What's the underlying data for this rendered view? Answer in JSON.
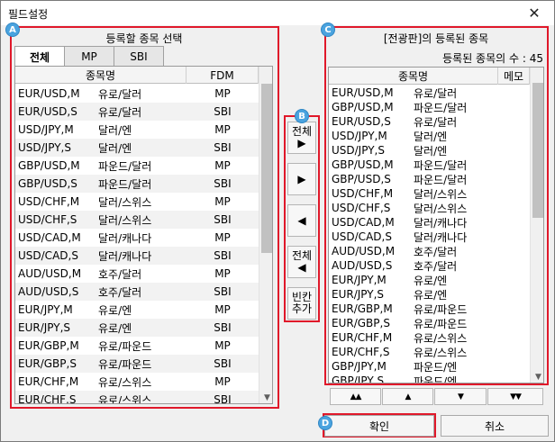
{
  "window": {
    "title": "필드설정",
    "close_glyph": "✕"
  },
  "markers": {
    "a": "A",
    "b": "B",
    "c": "C",
    "d": "D"
  },
  "left": {
    "title": "등록할 종목 선택",
    "tabs": [
      "전체",
      "MP",
      "SBI"
    ],
    "active_tab": 0,
    "columns": [
      "종목명",
      "FDM"
    ],
    "rows": [
      [
        "EUR/USD,M",
        "유로/달러",
        "MP"
      ],
      [
        "EUR/USD,S",
        "유로/달러",
        "SBI"
      ],
      [
        "USD/JPY,M",
        "달러/엔",
        "MP"
      ],
      [
        "USD/JPY,S",
        "달러/엔",
        "SBI"
      ],
      [
        "GBP/USD,M",
        "파운드/달러",
        "MP"
      ],
      [
        "GBP/USD,S",
        "파운드/달러",
        "SBI"
      ],
      [
        "USD/CHF,M",
        "달러/스위스",
        "MP"
      ],
      [
        "USD/CHF,S",
        "달러/스위스",
        "SBI"
      ],
      [
        "USD/CAD,M",
        "달러/캐나다",
        "MP"
      ],
      [
        "USD/CAD,S",
        "달러/캐나다",
        "SBI"
      ],
      [
        "AUD/USD,M",
        "호주/달러",
        "MP"
      ],
      [
        "AUD/USD,S",
        "호주/달러",
        "SBI"
      ],
      [
        "EUR/JPY,M",
        "유로/엔",
        "MP"
      ],
      [
        "EUR/JPY,S",
        "유로/엔",
        "SBI"
      ],
      [
        "EUR/GBP,M",
        "유로/파운드",
        "MP"
      ],
      [
        "EUR/GBP,S",
        "유로/파운드",
        "SBI"
      ],
      [
        "EUR/CHF,M",
        "유로/스위스",
        "MP"
      ],
      [
        "EUR/CHF,S",
        "유로/스위스",
        "SBI"
      ]
    ]
  },
  "middle": {
    "add_all_label": "전체",
    "add_all_arrow": "▶",
    "add_arrow": "▶",
    "remove_arrow": "◀",
    "remove_all_label": "전체",
    "remove_all_arrow": "◀",
    "add_blank_line1": "빈칸",
    "add_blank_line2": "추가"
  },
  "right": {
    "title": "[전광판]의 등록된 종목",
    "count_label": "등록된 종목의 수 :",
    "count_value": "45",
    "columns": [
      "종목명",
      "메모"
    ],
    "rows": [
      [
        "EUR/USD,M",
        "유로/달러"
      ],
      [
        "GBP/USD,M",
        "파운드/달러"
      ],
      [
        "EUR/USD,S",
        "유로/달러"
      ],
      [
        "USD/JPY,M",
        "달러/엔"
      ],
      [
        "USD/JPY,S",
        "달러/엔"
      ],
      [
        "GBP/USD,M",
        "파운드/달러"
      ],
      [
        "GBP/USD,S",
        "파운드/달러"
      ],
      [
        "USD/CHF,M",
        "달러/스위스"
      ],
      [
        "USD/CHF,S",
        "달러/스위스"
      ],
      [
        "USD/CAD,M",
        "달러/캐나다"
      ],
      [
        "USD/CAD,S",
        "달러/캐나다"
      ],
      [
        "AUD/USD,M",
        "호주/달러"
      ],
      [
        "AUD/USD,S",
        "호주/달러"
      ],
      [
        "EUR/JPY,M",
        "유로/엔"
      ],
      [
        "EUR/JPY,S",
        "유로/엔"
      ],
      [
        "EUR/GBP,M",
        "유로/파운드"
      ],
      [
        "EUR/GBP,S",
        "유로/파운드"
      ],
      [
        "EUR/CHF,M",
        "유로/스위스"
      ],
      [
        "EUR/CHF,S",
        "유로/스위스"
      ],
      [
        "GBP/JPY,M",
        "파운드/엔"
      ],
      [
        "GBP/JPY,S",
        "파운드/엔"
      ]
    ],
    "nav": [
      "▲▲",
      "▲",
      "▼",
      "▼▼"
    ]
  },
  "buttons": {
    "ok": "확인",
    "cancel": "취소"
  },
  "colors": {
    "highlight_border": "#e0182a",
    "marker": "#4aa3df",
    "alt_row": "#f2f2f2"
  },
  "scroll": {
    "left_visible_fraction": 0.55,
    "right_visible_fraction": 0.47
  }
}
